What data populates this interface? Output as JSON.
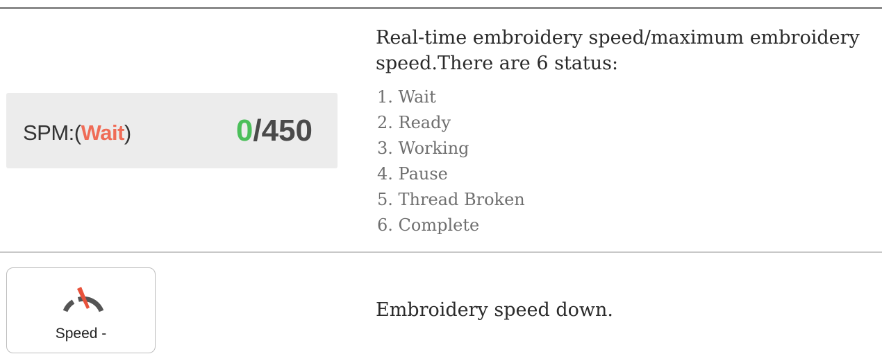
{
  "spm": {
    "prefix": "SPM:(",
    "status": "Wait",
    "suffix": ")",
    "current": "0",
    "separator": "/",
    "max": "450"
  },
  "spm_description": {
    "text": "Real-time embroidery speed/maximum embroidery speed.There are 6 status:",
    "statuses": [
      "1. Wait",
      "2. Ready",
      "3. Working",
      "4. Pause",
      "5. Thread Broken",
      "6. Complete"
    ]
  },
  "speed_down": {
    "button_label": "Speed -",
    "icon": "speedometer-icon",
    "description": "Embroidery speed down."
  },
  "colors": {
    "status_accent": "#ef6c57",
    "current_speed": "#4bbf5a",
    "panel_background": "#ececec"
  }
}
